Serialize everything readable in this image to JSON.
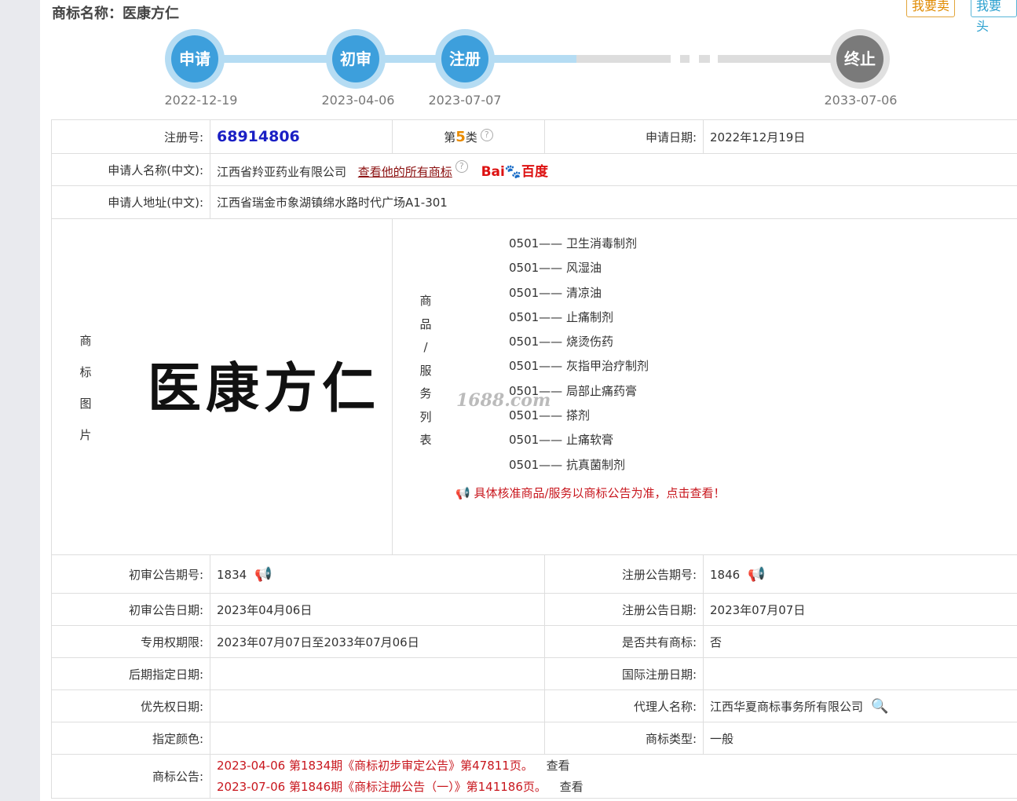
{
  "header": {
    "title": "商标名称：医康方仁",
    "btn_sell": "我要卖",
    "btn_buy": "我要头"
  },
  "timeline": {
    "steps": [
      {
        "label": "申请",
        "date": "2022-12-19"
      },
      {
        "label": "初审",
        "date": "2023-04-06"
      },
      {
        "label": "注册",
        "date": "2023-07-07"
      },
      {
        "label": "终止",
        "date": "2033-07-06"
      }
    ],
    "colors": {
      "done": "#3d9fdc",
      "done_ring": "#b5dcf3",
      "future": "#7a7a7a"
    }
  },
  "info": {
    "reg_no_label": "注册号:",
    "reg_no": "68914806",
    "class_prefix": "第",
    "class_num": "5",
    "class_suffix": "类",
    "apply_date_label": "申请日期:",
    "apply_date": "2022年12月19日",
    "applicant_label": "申请人名称(中文):",
    "applicant": "江西省羚亚药业有限公司",
    "applicant_link": "查看他的所有商标",
    "baidu_a": "Bai",
    "baidu_b": "百度",
    "address_label": "申请人地址(中文):",
    "address": "江西省瑞金市象湖镇绵水路时代广场A1-301",
    "image_label": [
      "商",
      "标",
      "图",
      "片"
    ],
    "mark_text": "医康方仁",
    "watermark": "1688.com",
    "goods_label": [
      "商",
      "品",
      "/",
      "服",
      "务",
      "列",
      "表"
    ],
    "goods": [
      "0501—— 卫生消毒制剂",
      "0501—— 风湿油",
      "0501—— 清凉油",
      "0501—— 止痛制剂",
      "0501—— 烧烫伤药",
      "0501—— 灰指甲治疗制剂",
      "0501—— 局部止痛药膏",
      "0501—— 搽剂",
      "0501—— 止痛软膏",
      "0501—— 抗真菌制剂"
    ],
    "goods_note": "具体核准商品/服务以商标公告为准，点击查看！",
    "prelim_no_label": "初审公告期号:",
    "prelim_no": "1834",
    "reg_pub_no_label": "注册公告期号:",
    "reg_pub_no": "1846",
    "prelim_date_label": "初审公告日期:",
    "prelim_date": "2023年04月06日",
    "reg_pub_date_label": "注册公告日期:",
    "reg_pub_date": "2023年07月07日",
    "term_label": "专用权期限:",
    "term": "2023年07月07日至2033年07月06日",
    "shared_label": "是否共有商标:",
    "shared": "否",
    "later_label": "后期指定日期:",
    "later": "",
    "intl_label": "国际注册日期:",
    "intl": "",
    "priority_label": "优先权日期:",
    "priority": "",
    "agent_label": "代理人名称:",
    "agent": "江西华夏商标事务所有限公司",
    "color_label": "指定颜色:",
    "color": "",
    "type_label": "商标类型:",
    "type": "一般",
    "notice_label": "商标公告:",
    "notices": [
      {
        "text": "2023-04-06 第1834期《商标初步审定公告》第47811页。",
        "action": "查看"
      },
      {
        "text": "2023-07-06 第1846期《商标注册公告（一）》第141186页。",
        "action": "查看"
      }
    ]
  }
}
